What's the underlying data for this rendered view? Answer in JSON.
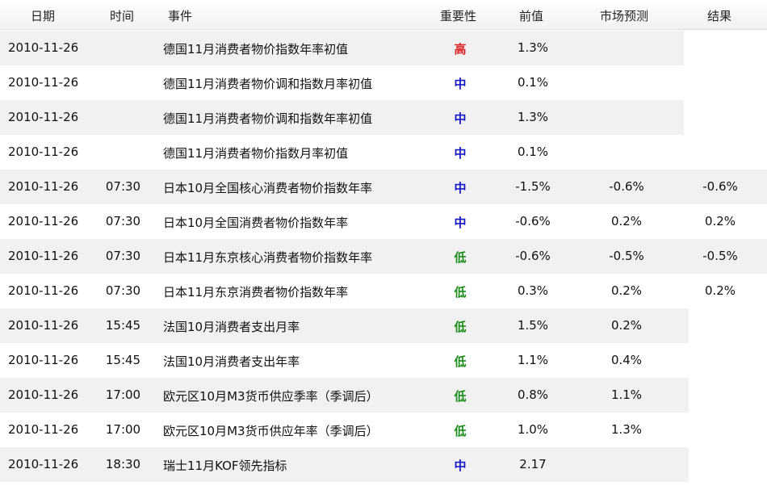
{
  "header": {
    "date": "日期",
    "time": "时间",
    "event": "事件",
    "importance": "重要性",
    "previous": "前值",
    "forecast": "市场预测",
    "actual": "结果"
  },
  "colors": {
    "high": "#e02020",
    "medium": "#1515c8",
    "low": "#1a8c1a",
    "row_shade": "#f1f1f1"
  },
  "rows": [
    {
      "date": "2010-11-26",
      "time": "",
      "event": "德国11月消费者物价指数年率初值",
      "importance": "高",
      "level": "high",
      "previous": "1.3%",
      "forecast": "",
      "actual": ""
    },
    {
      "date": "2010-11-26",
      "time": "",
      "event": "德国11月消费者物价调和指数月率初值",
      "importance": "中",
      "level": "mid",
      "previous": "0.1%",
      "forecast": "",
      "actual": ""
    },
    {
      "date": "2010-11-26",
      "time": "",
      "event": "德国11月消费者物价调和指数年率初值",
      "importance": "中",
      "level": "mid",
      "previous": "1.3%",
      "forecast": "",
      "actual": ""
    },
    {
      "date": "2010-11-26",
      "time": "",
      "event": "德国11月消费者物价指数月率初值",
      "importance": "中",
      "level": "mid",
      "previous": "0.1%",
      "forecast": "",
      "actual": ""
    },
    {
      "date": "2010-11-26",
      "time": "07:30",
      "event": "日本10月全国核心消费者物价指数年率",
      "importance": "中",
      "level": "mid",
      "previous": "-1.5%",
      "forecast": "-0.6%",
      "actual": "-0.6%"
    },
    {
      "date": "2010-11-26",
      "time": "07:30",
      "event": "日本10月全国消费者物价指数年率",
      "importance": "中",
      "level": "mid",
      "previous": "-0.6%",
      "forecast": "0.2%",
      "actual": "0.2%"
    },
    {
      "date": "2010-11-26",
      "time": "07:30",
      "event": "日本11月东京核心消费者物价指数年率",
      "importance": "低",
      "level": "low",
      "previous": "-0.6%",
      "forecast": "-0.5%",
      "actual": "-0.5%"
    },
    {
      "date": "2010-11-26",
      "time": "07:30",
      "event": "日本11月东京消费者物价指数年率",
      "importance": "低",
      "level": "low",
      "previous": "0.3%",
      "forecast": "0.2%",
      "actual": "0.2%"
    },
    {
      "date": "2010-11-26",
      "time": "15:45",
      "event": "法国10月消费者支出月率",
      "importance": "低",
      "level": "low",
      "previous": "1.5%",
      "forecast": "0.2%",
      "actual": ""
    },
    {
      "date": "2010-11-26",
      "time": "15:45",
      "event": "法国10月消费者支出年率",
      "importance": "低",
      "level": "low",
      "previous": "1.1%",
      "forecast": "0.4%",
      "actual": ""
    },
    {
      "date": "2010-11-26",
      "time": "17:00",
      "event": "欧元区10月M3货币供应季率（季调后）",
      "importance": "低",
      "level": "low",
      "previous": "0.8%",
      "forecast": "1.1%",
      "actual": ""
    },
    {
      "date": "2010-11-26",
      "time": "17:00",
      "event": "欧元区10月M3货币供应年率（季调后）",
      "importance": "低",
      "level": "low",
      "previous": "1.0%",
      "forecast": "1.3%",
      "actual": ""
    },
    {
      "date": "2010-11-26",
      "time": "18:30",
      "event": "瑞士11月KOF领先指标",
      "importance": "中",
      "level": "mid",
      "previous": "2.17",
      "forecast": "",
      "actual": ""
    }
  ]
}
